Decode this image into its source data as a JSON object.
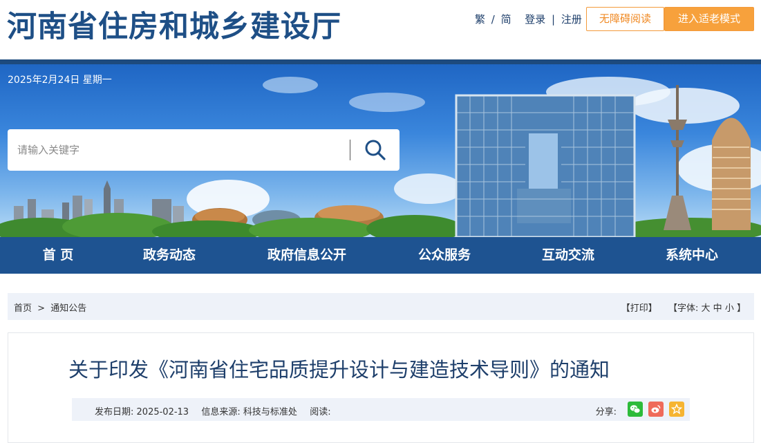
{
  "header": {
    "site_title": "河南省住房和城乡建设厅",
    "lang_trad": "繁",
    "lang_sep": "/",
    "lang_simp": "简",
    "login": "登录",
    "auth_sep": "|",
    "register": "注册",
    "accessibility_button": "无障碍阅读",
    "elder_mode_button": "进入适老模式"
  },
  "banner": {
    "date": "2025年2月24日 星期一",
    "search_placeholder": "请输入关键字",
    "search_icon": "search-icon"
  },
  "nav": {
    "items": [
      "首  页",
      "政务动态",
      "政府信息公开",
      "公众服务",
      "互动交流",
      "系统中心"
    ]
  },
  "breadcrumb": {
    "home": "首页",
    "arrow": ">",
    "current": "通知公告"
  },
  "tools": {
    "print": "【打印】",
    "font_prefix": "【字体:",
    "font_large": "大",
    "font_medium": "中",
    "font_small": "小",
    "font_suffix": "】"
  },
  "article": {
    "title": "关于印发《河南省住宅品质提升设计与建造技术导则》的通知",
    "publish_label": "发布日期:",
    "publish_date": "2025-02-13",
    "source_label": "信息来源:",
    "source": "科技与标准处",
    "read_label": "阅读:",
    "read_count": "",
    "share_label": "分享:",
    "share_icons": [
      "wechat-icon",
      "weibo-icon",
      "favorite-icon"
    ]
  },
  "colors": {
    "brand_blue": "#1e5391",
    "title_blue": "#1e4f86",
    "accent_orange": "#f7a13c",
    "wechat_green": "#2dbb3a",
    "weibo_red": "#ef6a5a",
    "favorite_yellow": "#f6b431"
  }
}
